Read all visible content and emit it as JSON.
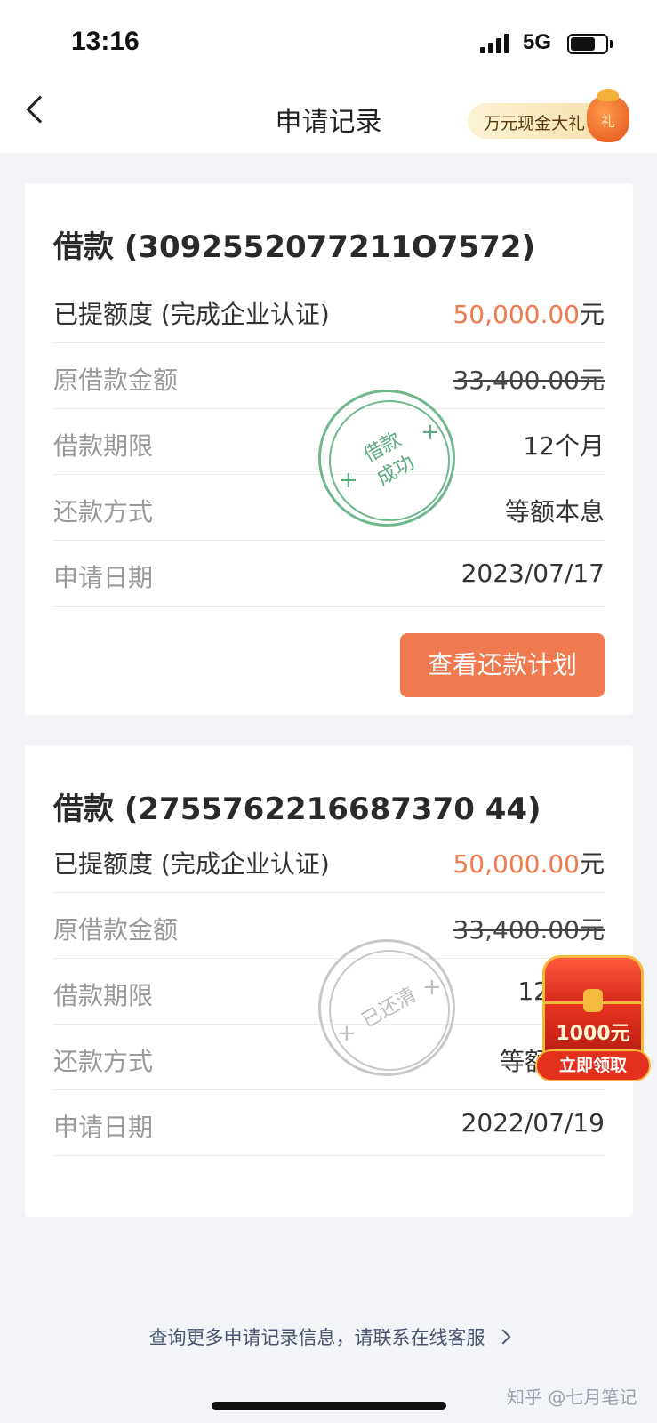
{
  "status_bar": {
    "time": "13:16",
    "network": "5G"
  },
  "nav": {
    "title": "申请记录",
    "promo_label": "万元现金大礼",
    "promo_bag_text": "礼"
  },
  "records": [
    {
      "title": "借款 (3092552077211O7572)",
      "rows": [
        {
          "label": "已提额度 (完成企业认证)",
          "amount": "50,000.00",
          "unit": "元"
        },
        {
          "label": "原借款金额",
          "value": "33,400.00元"
        },
        {
          "label": "借款期限",
          "value": "12个月"
        },
        {
          "label": "还款方式",
          "value": "等额本息"
        },
        {
          "label": "申请日期",
          "value": "2023/07/17"
        }
      ],
      "stamp": {
        "line1": "借款",
        "line2": "成功"
      },
      "button_label": "查看还款计划"
    },
    {
      "title": "借款 (2755762216687370 44)",
      "rows": [
        {
          "label": "已提额度 (完成企业认证)",
          "amount": "50,000.00",
          "unit": "元"
        },
        {
          "label": "原借款金额",
          "value": "33,400.00元"
        },
        {
          "label": "借款期限",
          "value": "12"
        },
        {
          "label": "还款方式",
          "value": "等额"
        },
        {
          "label": "申请日期",
          "value": "2022/07/19"
        }
      ],
      "stamp": {
        "line1": "已还清"
      }
    }
  ],
  "floating_reward": {
    "amount": "1000元",
    "button_label": "立即领取"
  },
  "footer": {
    "link_text": "查询更多申请记录信息，请联系在线客服"
  },
  "watermark": "知乎 @七月笔记",
  "colors": {
    "accent": "#f07a50",
    "amount": "#ef7a4d",
    "stamp_success": "#6fb88d",
    "stamp_cleared": "#c8c8c8"
  }
}
